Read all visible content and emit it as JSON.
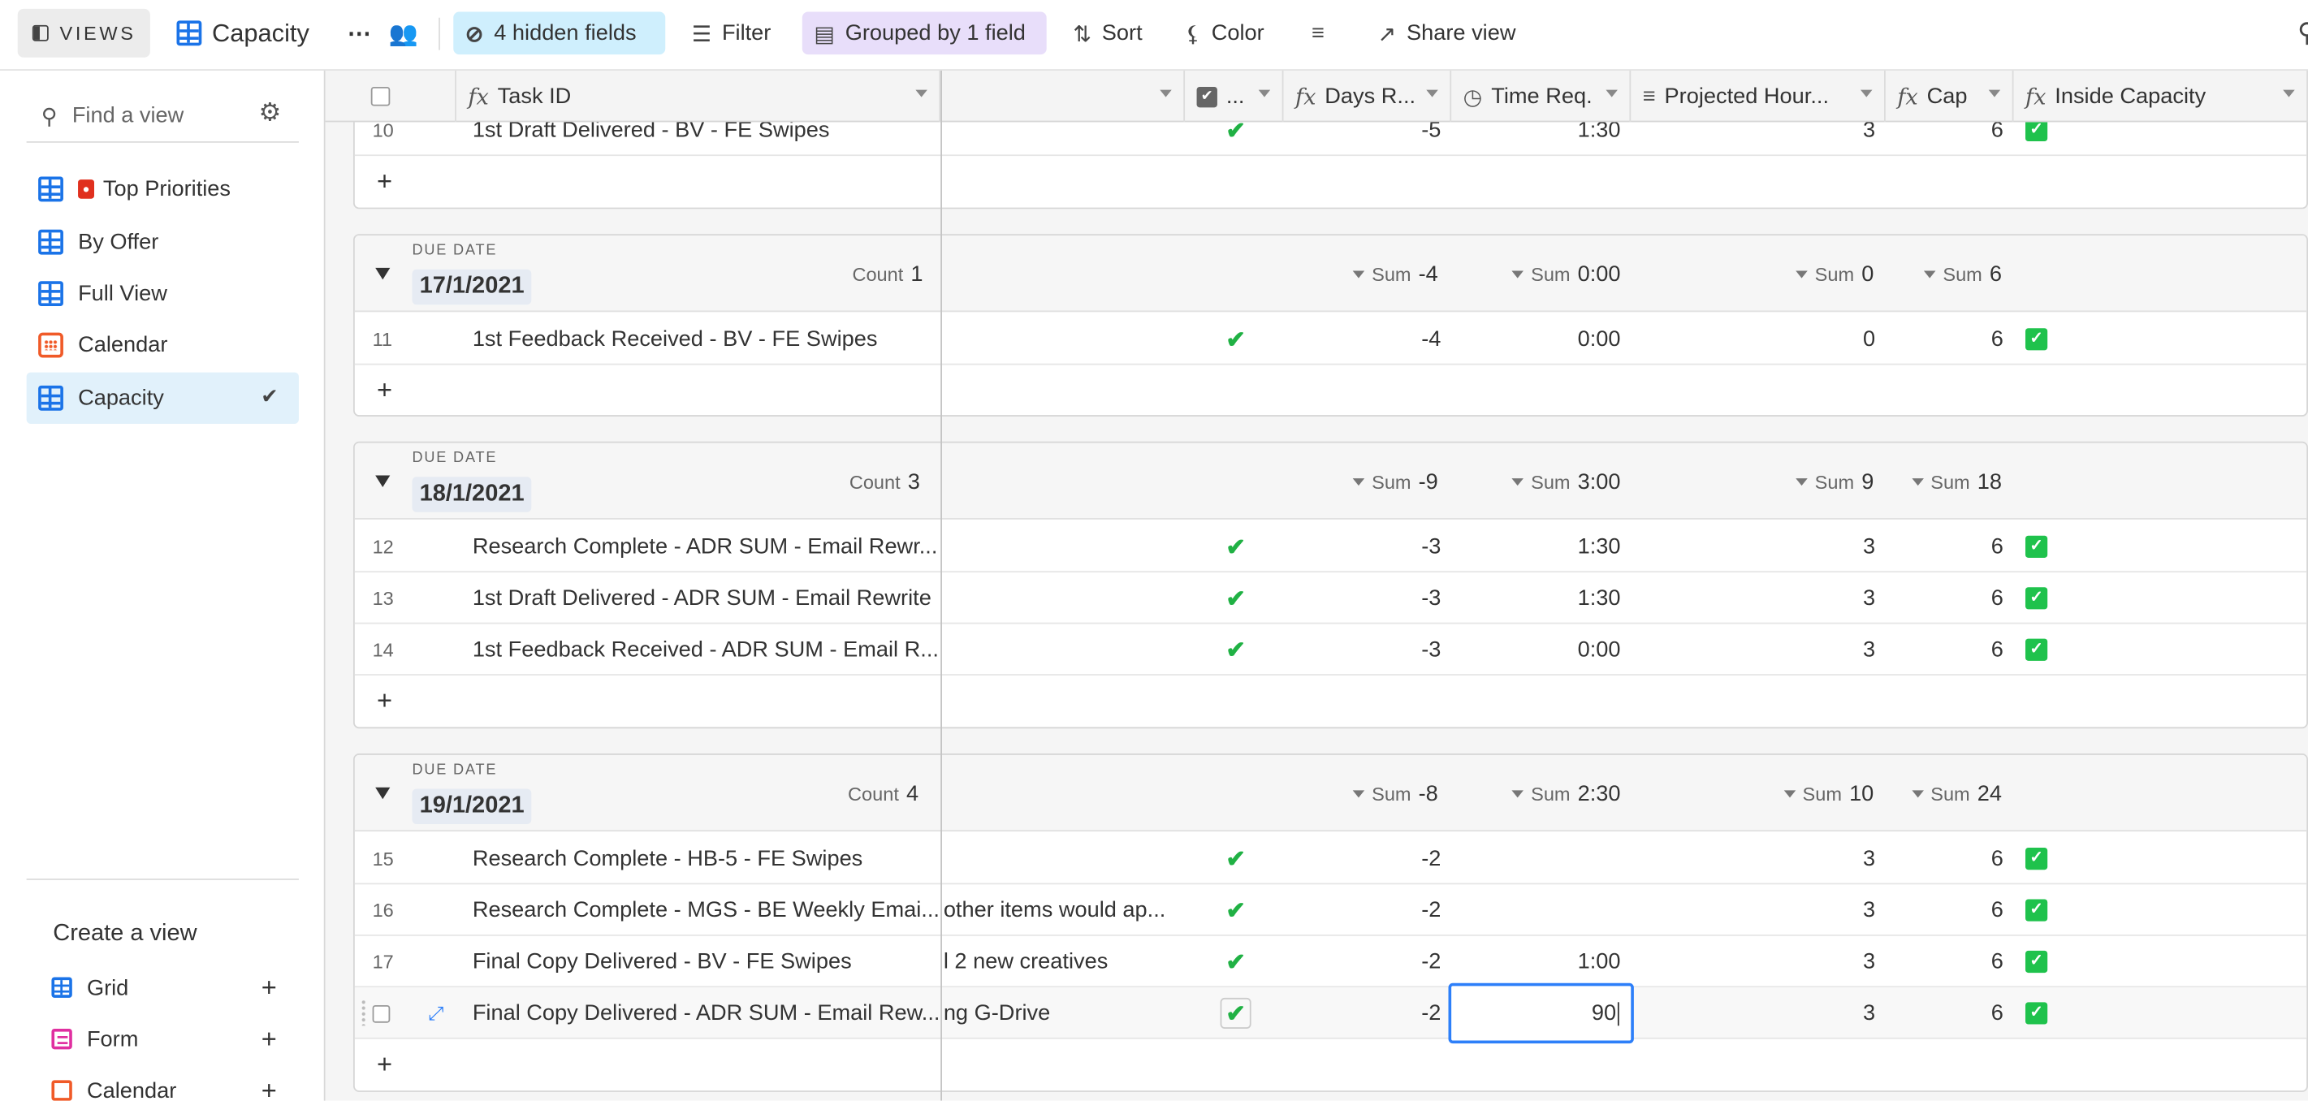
{
  "toolbar": {
    "views_label": "VIEWS",
    "title": "Capacity",
    "hidden_fields": "4 hidden fields",
    "filter": "Filter",
    "grouped": "Grouped by 1 field",
    "sort": "Sort",
    "color": "Color",
    "share": "Share view"
  },
  "sidebar": {
    "find_placeholder": "Find a view",
    "views": [
      {
        "label": "Top Priorities",
        "icon": "grid-icon"
      },
      {
        "label": "By Offer",
        "icon": "grid-icon"
      },
      {
        "label": "Full View",
        "icon": "grid-icon"
      },
      {
        "label": "Calendar",
        "icon": "calendar-icon"
      },
      {
        "label": "Capacity",
        "icon": "grid-icon"
      }
    ],
    "create_title": "Create a view",
    "create_items": [
      {
        "label": "Grid"
      },
      {
        "label": "Form"
      },
      {
        "label": "Calendar"
      }
    ]
  },
  "columns": {
    "task_id": "Task ID",
    "check": "...",
    "days": "Days R...",
    "time": "Time Req.",
    "projected": "Projected Hour...",
    "cap": "Cap",
    "inside": "Inside Capacity"
  },
  "sum_label": "Sum",
  "count_label": "Count",
  "group_label": "DUE DATE",
  "top_row": {
    "num": "10",
    "task": "1st Draft Delivered - BV - FE Swipes",
    "days": "-5",
    "time": "1:30",
    "proj": "3",
    "cap": "6"
  },
  "groups": [
    {
      "date": "17/1/2021",
      "count": "1",
      "sums": {
        "days": "-4",
        "time": "0:00",
        "proj": "0",
        "cap": "6"
      },
      "rows": [
        {
          "num": "11",
          "task": "1st Feedback Received - BV - FE Swipes",
          "note": "",
          "days": "-4",
          "time": "0:00",
          "proj": "0",
          "cap": "6"
        }
      ]
    },
    {
      "date": "18/1/2021",
      "count": "3",
      "sums": {
        "days": "-9",
        "time": "3:00",
        "proj": "9",
        "cap": "18"
      },
      "rows": [
        {
          "num": "12",
          "task": "Research Complete - ADR SUM - Email Rewr...",
          "note": "",
          "days": "-3",
          "time": "1:30",
          "proj": "3",
          "cap": "6"
        },
        {
          "num": "13",
          "task": "1st Draft Delivered - ADR SUM - Email Rewrite",
          "note": "",
          "days": "-3",
          "time": "1:30",
          "proj": "3",
          "cap": "6"
        },
        {
          "num": "14",
          "task": "1st Feedback Received - ADR SUM - Email R...",
          "note": "",
          "days": "-3",
          "time": "0:00",
          "proj": "3",
          "cap": "6"
        }
      ]
    },
    {
      "date": "19/1/2021",
      "count": "4",
      "sums": {
        "days": "-8",
        "time": "2:30",
        "proj": "10",
        "cap": "24"
      },
      "rows": [
        {
          "num": "15",
          "task": "Research Complete - HB-5 - FE Swipes",
          "note": "",
          "days": "-2",
          "time": "",
          "proj": "3",
          "cap": "6"
        },
        {
          "num": "16",
          "task": "Research Complete - MGS - BE Weekly Emai...",
          "note": "other items would ap...",
          "days": "-2",
          "time": "",
          "proj": "3",
          "cap": "6"
        },
        {
          "num": "17",
          "task": "Final Copy Delivered - BV - FE Swipes",
          "note": "l 2 new creatives",
          "days": "-2",
          "time": "1:00",
          "proj": "3",
          "cap": "6"
        },
        {
          "num": "",
          "task": "Final Copy Delivered - ADR SUM - Email Rew...",
          "note": "ng G-Drive",
          "days": "-2",
          "time": "90",
          "proj": "3",
          "cap": "6"
        }
      ]
    }
  ]
}
